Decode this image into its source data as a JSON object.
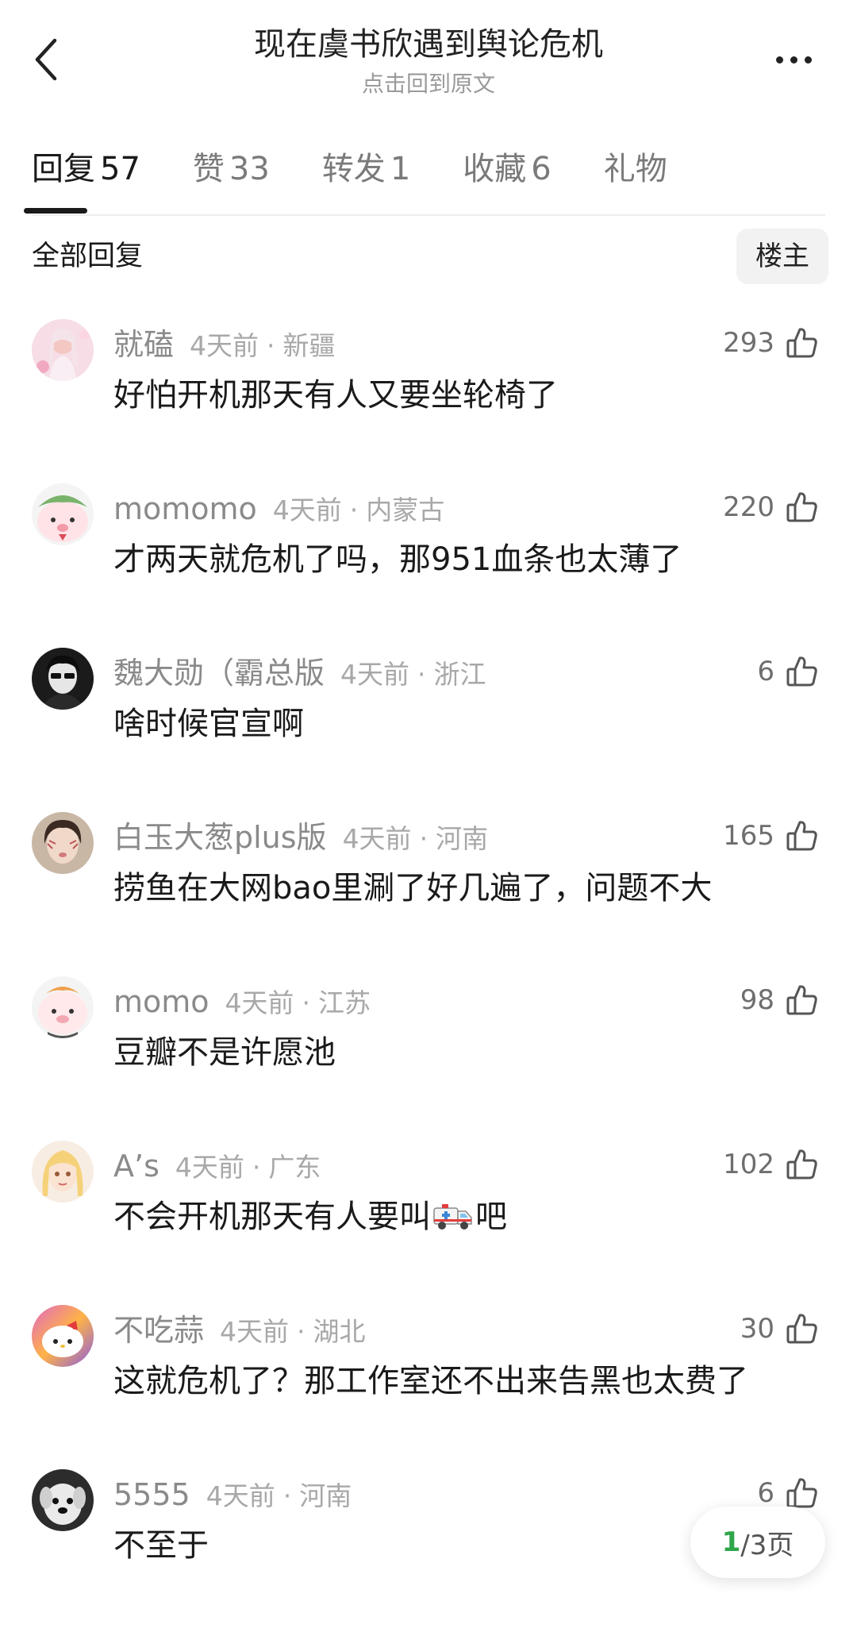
{
  "header": {
    "title": "现在虞书欣遇到舆论危机",
    "subtitle": "点击回到原文"
  },
  "tabs": [
    {
      "label": "回复",
      "count": "57"
    },
    {
      "label": "赞",
      "count": "33"
    },
    {
      "label": "转发",
      "count": "1"
    },
    {
      "label": "收藏",
      "count": "6"
    },
    {
      "label": "礼物",
      "count": ""
    }
  ],
  "section": {
    "title": "全部回复",
    "owner_button": "楼主"
  },
  "comments": [
    {
      "user": "就磕",
      "time": "4天前",
      "sep": "·",
      "region": "新疆",
      "text": "好怕开机那天有人又要坐轮椅了",
      "likes": "293"
    },
    {
      "user": "momomo",
      "time": "4天前",
      "sep": "·",
      "region": "内蒙古",
      "text": "才两天就危机了吗，那951血条也太薄了",
      "likes": "220"
    },
    {
      "user": "魏大勋（霸总版",
      "time": "4天前",
      "sep": "·",
      "region": "浙江",
      "text": "啥时候官宣啊",
      "likes": "6"
    },
    {
      "user": "白玉大葱plus版",
      "time": "4天前",
      "sep": "·",
      "region": "河南",
      "text": "捞鱼在大网bao里涮了好几遍了，问题不大",
      "likes": "165"
    },
    {
      "user": "momo",
      "time": "4天前",
      "sep": "·",
      "region": "江苏",
      "text": "豆瓣不是许愿池",
      "likes": "98"
    },
    {
      "user": "A’s",
      "time": "4天前",
      "sep": "·",
      "region": "广东",
      "text_before": "不会开机那天有人要叫",
      "emoji": "ambulance",
      "text_after": "吧",
      "likes": "102"
    },
    {
      "user": "不吃蒜",
      "time": "4天前",
      "sep": "·",
      "region": "湖北",
      "text": "这就危机了？那工作室还不出来告黑也太费了",
      "likes": "30"
    },
    {
      "user": "5555",
      "time": "4天前",
      "sep": "·",
      "region": "河南",
      "text": "不至于",
      "likes": "6"
    }
  ],
  "pager": {
    "current": "1",
    "total_text": "/3页"
  },
  "colors": {
    "text": "#1a1a1a",
    "meta": "#a8a8a8",
    "pager_current": "#2fa64a"
  }
}
